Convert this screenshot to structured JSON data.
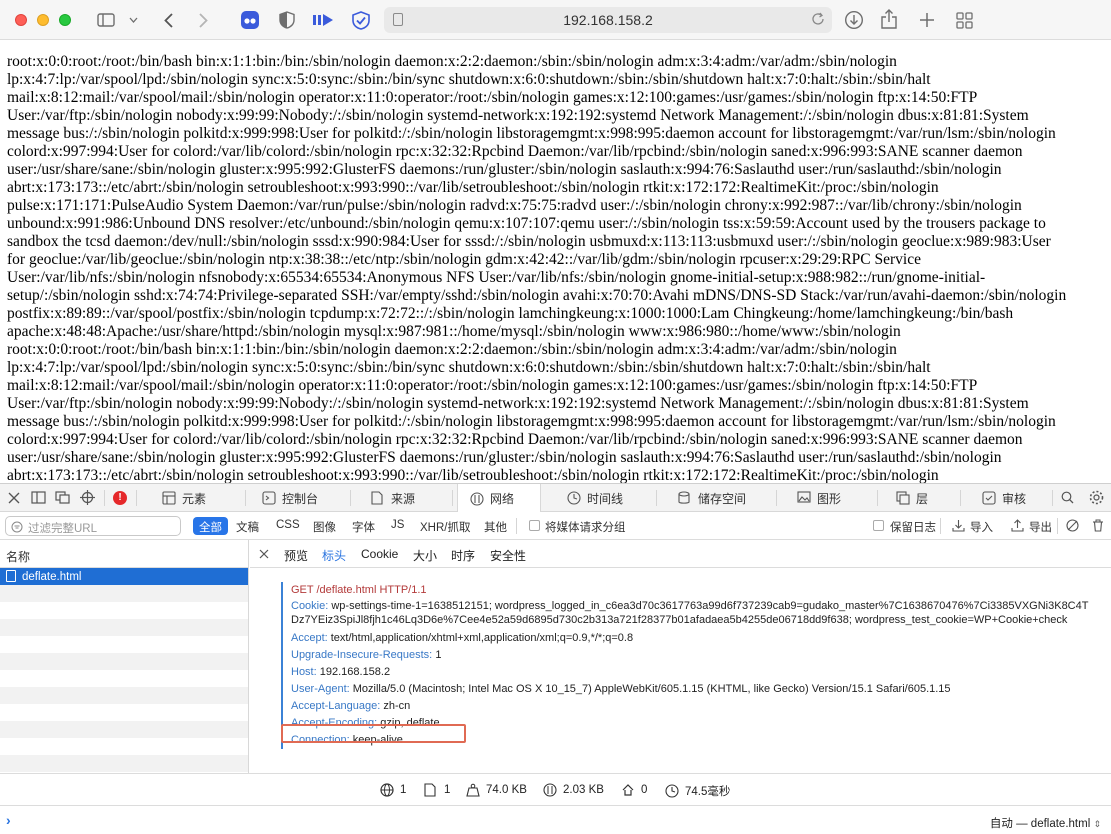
{
  "browser": {
    "url": "192.168.158.2"
  },
  "page": {
    "lines": [
      "root:x:0:0:root:/root:/bin/bash bin:x:1:1:bin:/bin:/sbin/nologin daemon:x:2:2:daemon:/sbin:/sbin/nologin adm:x:3:4:adm:/var/adm:/sbin/nologin",
      "lp:x:4:7:lp:/var/spool/lpd:/sbin/nologin sync:x:5:0:sync:/sbin:/bin/sync shutdown:x:6:0:shutdown:/sbin:/sbin/shutdown halt:x:7:0:halt:/sbin:/sbin/halt",
      "mail:x:8:12:mail:/var/spool/mail:/sbin/nologin operator:x:11:0:operator:/root:/sbin/nologin games:x:12:100:games:/usr/games:/sbin/nologin ftp:x:14:50:FTP",
      "User:/var/ftp:/sbin/nologin nobody:x:99:99:Nobody:/:/sbin/nologin systemd-network:x:192:192:systemd Network Management:/:/sbin/nologin dbus:x:81:81:System",
      "message bus:/:/sbin/nologin polkitd:x:999:998:User for polkitd:/:/sbin/nologin libstoragemgmt:x:998:995:daemon account for libstoragemgmt:/var/run/lsm:/sbin/nologin",
      "colord:x:997:994:User for colord:/var/lib/colord:/sbin/nologin rpc:x:32:32:Rpcbind Daemon:/var/lib/rpcbind:/sbin/nologin saned:x:996:993:SANE scanner daemon",
      "user:/usr/share/sane:/sbin/nologin gluster:x:995:992:GlusterFS daemons:/run/gluster:/sbin/nologin saslauth:x:994:76:Saslauthd user:/run/saslauthd:/sbin/nologin",
      "abrt:x:173:173::/etc/abrt:/sbin/nologin setroubleshoot:x:993:990::/var/lib/setroubleshoot:/sbin/nologin rtkit:x:172:172:RealtimeKit:/proc:/sbin/nologin",
      "pulse:x:171:171:PulseAudio System Daemon:/var/run/pulse:/sbin/nologin radvd:x:75:75:radvd user:/:/sbin/nologin chrony:x:992:987::/var/lib/chrony:/sbin/nologin",
      "unbound:x:991:986:Unbound DNS resolver:/etc/unbound:/sbin/nologin qemu:x:107:107:qemu user:/:/sbin/nologin tss:x:59:59:Account used by the trousers package to",
      "sandbox the tcsd daemon:/dev/null:/sbin/nologin sssd:x:990:984:User for sssd:/:/sbin/nologin usbmuxd:x:113:113:usbmuxd user:/:/sbin/nologin geoclue:x:989:983:User",
      "for geoclue:/var/lib/geoclue:/sbin/nologin ntp:x:38:38::/etc/ntp:/sbin/nologin gdm:x:42:42::/var/lib/gdm:/sbin/nologin rpcuser:x:29:29:RPC Service",
      "User:/var/lib/nfs:/sbin/nologin nfsnobody:x:65534:65534:Anonymous NFS User:/var/lib/nfs:/sbin/nologin gnome-initial-setup:x:988:982::/run/gnome-initial-",
      "setup/:/sbin/nologin sshd:x:74:74:Privilege-separated SSH:/var/empty/sshd:/sbin/nologin avahi:x:70:70:Avahi mDNS/DNS-SD Stack:/var/run/avahi-daemon:/sbin/nologin",
      "postfix:x:89:89::/var/spool/postfix:/sbin/nologin tcpdump:x:72:72::/:/sbin/nologin lamchingkeung:x:1000:1000:Lam Chingkeung:/home/lamchingkeung:/bin/bash",
      "apache:x:48:48:Apache:/usr/share/httpd:/sbin/nologin mysql:x:987:981::/home/mysql:/sbin/nologin www:x:986:980::/home/www:/sbin/nologin",
      "root:x:0:0:root:/root:/bin/bash bin:x:1:1:bin:/bin:/sbin/nologin daemon:x:2:2:daemon:/sbin:/sbin/nologin adm:x:3:4:adm:/var/adm:/sbin/nologin",
      "lp:x:4:7:lp:/var/spool/lpd:/sbin/nologin sync:x:5:0:sync:/sbin:/bin/sync shutdown:x:6:0:shutdown:/sbin:/sbin/shutdown halt:x:7:0:halt:/sbin:/sbin/halt",
      "mail:x:8:12:mail:/var/spool/mail:/sbin/nologin operator:x:11:0:operator:/root:/sbin/nologin games:x:12:100:games:/usr/games:/sbin/nologin ftp:x:14:50:FTP",
      "User:/var/ftp:/sbin/nologin nobody:x:99:99:Nobody:/:/sbin/nologin systemd-network:x:192:192:systemd Network Management:/:/sbin/nologin dbus:x:81:81:System",
      "message bus:/:/sbin/nologin polkitd:x:999:998:User for polkitd:/:/sbin/nologin libstoragemgmt:x:998:995:daemon account for libstoragemgmt:/var/run/lsm:/sbin/nologin",
      "colord:x:997:994:User for colord:/var/lib/colord:/sbin/nologin rpc:x:32:32:Rpcbind Daemon:/var/lib/rpcbind:/sbin/nologin saned:x:996:993:SANE scanner daemon",
      "user:/usr/share/sane:/sbin/nologin gluster:x:995:992:GlusterFS daemons:/run/gluster:/sbin/nologin saslauth:x:994:76:Saslauthd user:/run/saslauthd:/sbin/nologin",
      "abrt:x:173:173::/etc/abrt:/sbin/nologin setroubleshoot:x:993:990::/var/lib/setroubleshoot:/sbin/nologin rtkit:x:172:172:RealtimeKit:/proc:/sbin/nologin"
    ]
  },
  "devtools": {
    "tabs": [
      "元素",
      "控制台",
      "来源",
      "网络",
      "时间线",
      "储存空间",
      "图形",
      "层",
      "审核"
    ],
    "filter_placeholder": "过滤完整URL",
    "type_filters": [
      "全部",
      "文稿",
      "CSS",
      "图像",
      "字体",
      "JS",
      "XHR/抓取",
      "其他"
    ],
    "media_checkbox": "将媒体请求分组",
    "preserve_log": "保留日志",
    "import": "导入",
    "export": "导出",
    "name_header": "名称",
    "request_name": "deflate.html",
    "detail_tabs": [
      "预览",
      "标头",
      "Cookie",
      "大小",
      "时序",
      "安全性"
    ],
    "request_line": "GET /deflate.html HTTP/1.1",
    "headers": [
      {
        "key": "Cookie:",
        "value": "wp-settings-time-1=1638512151; wordpress_logged_in_c6ea3d70c3617763a99d6f737239cab9=gudako_master%7C1638670476%7Ci3385VXGNi3K8C4TDz7YEiz3SpiJl8fjh1c46Lq3D6e%7Cee4e52a59d6895d730c2b313a721f28377b01afadaea5b4255de06718dd9f638; wordpress_test_cookie=WP+Cookie+check"
      },
      {
        "key": "Accept:",
        "value": "text/html,application/xhtml+xml,application/xml;q=0.9,*/*;q=0.8"
      },
      {
        "key": "Upgrade-Insecure-Requests:",
        "value": "1"
      },
      {
        "key": "Host:",
        "value": "192.168.158.2"
      },
      {
        "key": "User-Agent:",
        "value": "Mozilla/5.0 (Macintosh; Intel Mac OS X 10_15_7) AppleWebKit/605.1.15 (KHTML, like Gecko) Version/15.1 Safari/605.1.15"
      },
      {
        "key": "Accept-Language:",
        "value": "zh-cn"
      },
      {
        "key": "Accept-Encoding:",
        "value": "gzip, deflate"
      },
      {
        "key": "Connection:",
        "value": "keep-alive"
      }
    ],
    "status": {
      "domains": "1",
      "resources": "1",
      "transferred": "74.0 KB",
      "size": "2.03 KB",
      "redirects": "0",
      "time": "74.5毫秒"
    },
    "context": "自动 — deflate.html"
  }
}
